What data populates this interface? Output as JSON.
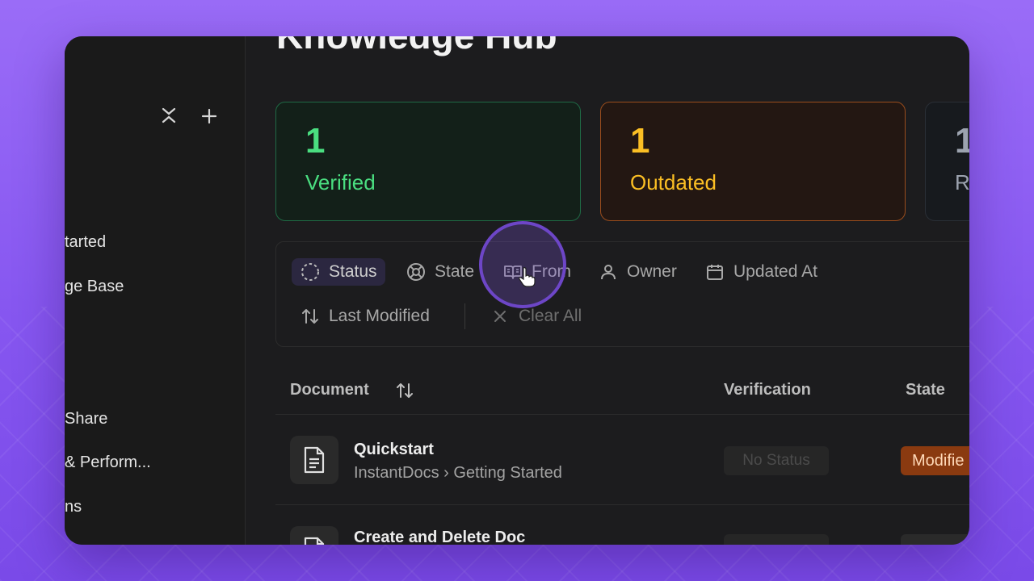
{
  "page": {
    "title": "Knowledge Hub"
  },
  "sidebar": {
    "tools": {
      "collapse_icon": "collapse-icon",
      "add_icon": "plus-icon"
    },
    "items": [
      {
        "label": "tarted"
      },
      {
        "label": "ge Base"
      },
      {
        "label": "Share"
      },
      {
        "label": "& Perform..."
      },
      {
        "label": "ns"
      }
    ]
  },
  "stats": [
    {
      "count": "1",
      "label": "Verified",
      "color": "#4ade80"
    },
    {
      "count": "1",
      "label": "Outdated",
      "color": "#fbbf24"
    },
    {
      "count": "1",
      "label": "R",
      "color": "#9ca3af"
    }
  ],
  "filters": {
    "status": "Status",
    "state": "State",
    "from": "From",
    "owner": "Owner",
    "updated_at": "Updated At",
    "last_modified": "Last Modified",
    "clear_all": "Clear All"
  },
  "table": {
    "columns": {
      "document": "Document",
      "verification": "Verification",
      "state": "State"
    },
    "rows": [
      {
        "title": "Quickstart",
        "path": "InstantDocs › Getting Started",
        "verification": "No Status",
        "state": "Modifie"
      },
      {
        "title": "Create and Delete Doc"
      }
    ]
  },
  "colors": {
    "accent": "#7c56dc",
    "window_bg": "#1c1c1e"
  }
}
